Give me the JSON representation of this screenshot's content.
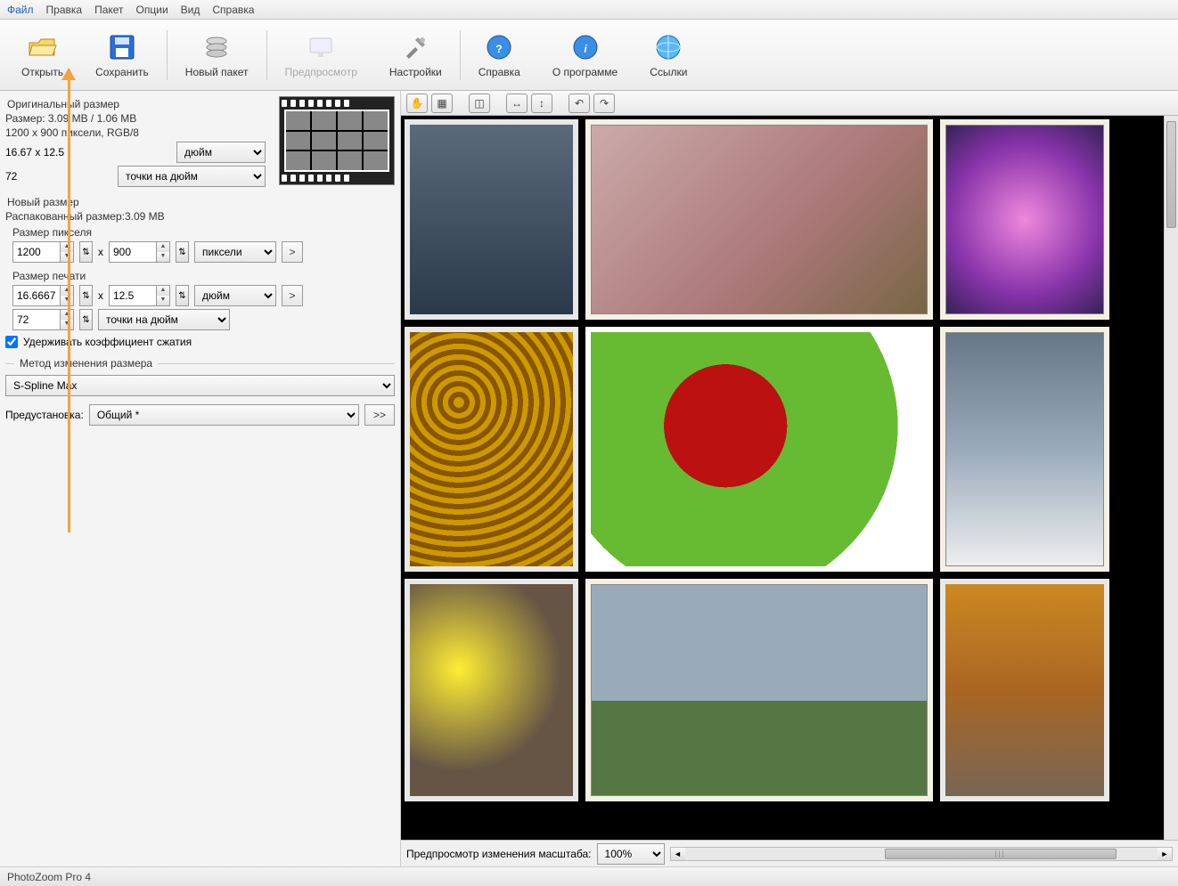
{
  "menu": {
    "file": "Файл",
    "edit": "Правка",
    "batch": "Пакет",
    "options": "Опции",
    "view": "Вид",
    "help": "Справка"
  },
  "toolbar": {
    "open": "Открыть",
    "save": "Сохранить",
    "newbatch": "Новый пакет",
    "preview": "Предпросмотр",
    "settings": "Настройки",
    "helpbtn": "Справка",
    "about": "О программе",
    "links": "Ссылки"
  },
  "orig": {
    "title": "Оригинальный размер",
    "sizeLine": "Размер: 3.09 МВ / 1.06 МВ",
    "pixelsLine": "1200 x 900 пиксели, RGB/8",
    "dimPhys": "16.67 x 12.5",
    "unit": "дюйм",
    "dpi": "72",
    "dpiUnit": "точки на дюйм"
  },
  "newsize": {
    "title": "Новый размер",
    "unpacked": "Распакованный размер:3.09 МВ",
    "pixelTitle": "Размер пикселя",
    "width": "1200",
    "height": "900",
    "pxUnit": "пиксели",
    "printTitle": "Размер печати",
    "pw": "16.6667",
    "ph": "12.5",
    "pUnit": "дюйм",
    "pdpi": "72",
    "pdpiUnit": "точки на дюйм",
    "constrain": "Удерживать коэффициент сжатия",
    "methodTitle": "Метод изменения размера",
    "method": "S-Spline Max",
    "presetLabel": "Предустановка:",
    "preset": "Общий *"
  },
  "bottom": {
    "label": "Предпросмотр изменения масштаба:",
    "zoom": "100%"
  },
  "status": {
    "app": "PhotoZoom Pro 4"
  },
  "x": "x",
  "go": ">",
  "more": ">>"
}
